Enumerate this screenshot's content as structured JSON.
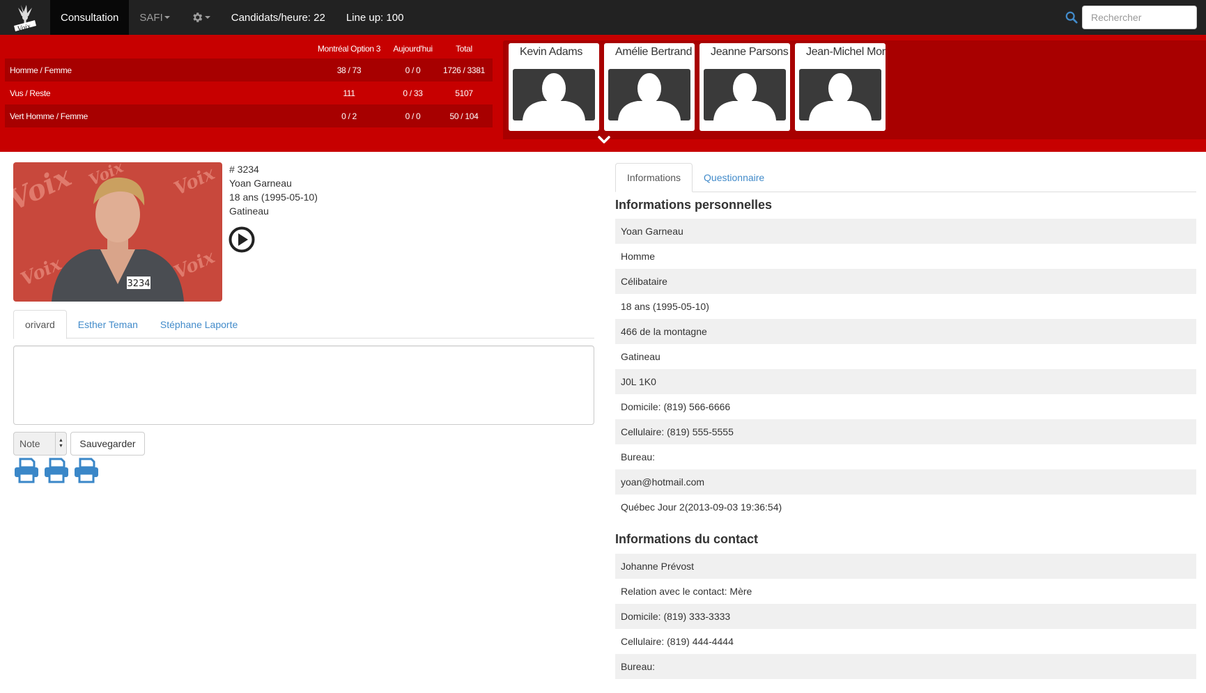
{
  "navbar": {
    "logo_text": "Voix",
    "items": [
      {
        "label": "Consultation"
      },
      {
        "label": "SAFI"
      }
    ],
    "candidates_per_hour": "Candidats/heure: 22",
    "line_up": "Line up: 100",
    "search_placeholder": "Rechercher",
    "icons": [
      "logo",
      "gear-icon",
      "search-icon"
    ]
  },
  "stats": {
    "headers": [
      "",
      "Montréal Option 3",
      "Aujourd'hui",
      "Total"
    ],
    "rows": [
      {
        "label": "Homme / Femme",
        "mtl": "38 / 73",
        "today": "0 / 0",
        "total": "1726 / 3381"
      },
      {
        "label": "Vus / Reste",
        "mtl": "111",
        "today": "0 / 33",
        "total": "5107"
      },
      {
        "label": "Vert Homme / Femme",
        "mtl": "0 / 2",
        "today": "0 / 0",
        "total": "50 / 104"
      }
    ]
  },
  "lineup_cards": [
    {
      "name": "Kevin Adams"
    },
    {
      "name": "Amélie Bertrand"
    },
    {
      "name": "Jeanne Parsons"
    },
    {
      "name": "Jean-Michel Mor"
    }
  ],
  "candidate": {
    "number": "# 3234",
    "name": "Yoan Garneau",
    "age": "18 ans (1995-05-10)",
    "city": "Gatineau",
    "badge": "3234",
    "photo_text": "Voix"
  },
  "judges_tabs": [
    {
      "label": "orivard"
    },
    {
      "label": "Esther Teman"
    },
    {
      "label": "Stéphane Laporte"
    }
  ],
  "note_form": {
    "textarea_value": "",
    "select_value": "Note",
    "save_label": "Sauvegarder"
  },
  "right_tabs": [
    {
      "label": "Informations"
    },
    {
      "label": "Questionnaire"
    }
  ],
  "personal": {
    "title": "Informations personnelles",
    "rows": [
      "Yoan Garneau",
      "Homme",
      "Célibataire",
      "18 ans (1995-05-10)",
      "466 de la montagne",
      "Gatineau",
      "J0L 1K0",
      "Domicile: (819) 566-6666",
      "Cellulaire: (819) 555-5555",
      "Bureau:",
      "yoan@hotmail.com",
      "Québec Jour 2(2013-09-03 19:36:54)"
    ]
  },
  "contact": {
    "title": "Informations du contact",
    "rows": [
      "Johanne Prévost",
      "Relation avec le contact: Mère",
      "Domicile: (819) 333-3333",
      "Cellulaire: (819) 444-4444",
      "Bureau:"
    ]
  },
  "colors": {
    "navbar": "#222222",
    "red_band": "#c70000",
    "red_dark": "#a70000",
    "link": "#428bca",
    "print_icon": "#3a87c8"
  }
}
